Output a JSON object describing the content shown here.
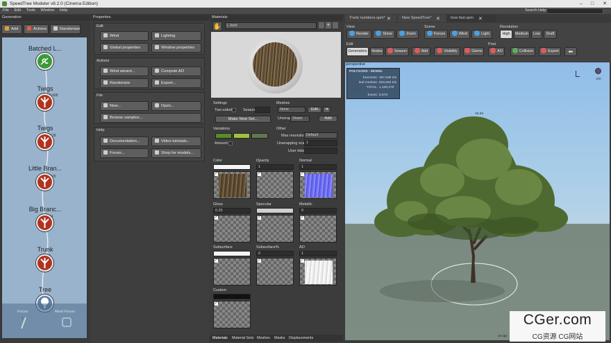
{
  "app_title": "SpeedTree Modeler v8.2.0 (Cinema Edition)",
  "menu": [
    "File",
    "Edit",
    "Tools",
    "Window",
    "Help"
  ],
  "search_label": "Search Help:",
  "generation": {
    "title": "Generation",
    "add": "Add",
    "actions": "Actions",
    "randomize": "Randomize",
    "nodes": [
      {
        "label": "Batched L...",
        "color": "#3a9a3a"
      },
      {
        "label": "Twigs",
        "color": "#b0331f"
      },
      {
        "label": "Twigs",
        "color": "#b0331f"
      },
      {
        "label": "Little Bran...",
        "color": "#b0331f"
      },
      {
        "label": "Big Branc...",
        "color": "#b0331f"
      },
      {
        "label": "Trunk",
        "color": "#b0331f"
      },
      {
        "label": "Tree",
        "color": "#5a7fb0"
      }
    ],
    "edge_counts": [
      "10,408",
      "4,128",
      "1,329",
      "204",
      "16",
      "1"
    ],
    "bottom": [
      "Forces",
      "Mesh Forces"
    ]
  },
  "properties": {
    "title": "Properties",
    "edit": {
      "heading": "Edit",
      "buttons": [
        "Wind",
        "Lighting",
        "Global properties",
        "Window properties"
      ]
    },
    "actions": {
      "heading": "Actions",
      "buttons": [
        "Wind wizard...",
        "Compute AO",
        "Randomize",
        "Export..."
      ]
    },
    "file": {
      "heading": "File",
      "buttons": [
        "New...",
        "Open...",
        "Browse samples..."
      ]
    },
    "help": {
      "heading": "Help",
      "buttons": [
        "Documentation...",
        "Video tutorials...",
        "Forum...",
        "Shop for models..."
      ]
    }
  },
  "materials": {
    "title": "Materials",
    "selected": "L.bark",
    "settings": {
      "heading": "Settings",
      "two_sided": "Two-sided",
      "season": "Season",
      "make_new_set": "Make New Set..."
    },
    "meshes": {
      "heading": "Meshes",
      "value": "None",
      "edit": "Edit...",
      "unwrap": "Unwrap",
      "unwrap_value": "Share",
      "add": "Add"
    },
    "variations": {
      "heading": "Variations",
      "amount": "Amount",
      "colors": [
        "#5a8a2a",
        "#a0c040",
        "#607850"
      ]
    },
    "other": {
      "heading": "Other",
      "max_resolution": "Max resolution",
      "max_resolution_value": "Default",
      "unwrapping_scale": "Unwrapping scale",
      "unwrapping_scale_value": "1",
      "user_data": "User data"
    },
    "maps": [
      {
        "name": "Color",
        "value": ""
      },
      {
        "name": "Opacity",
        "value": "1"
      },
      {
        "name": "Normal",
        "value": "1"
      },
      {
        "name": "Gloss",
        "value": "0.25"
      },
      {
        "name": "Specular",
        "value": ""
      },
      {
        "name": "Metallic",
        "value": "0"
      },
      {
        "name": "Subsurface",
        "value": ""
      },
      {
        "name": "Subsurface%",
        "value": "0"
      },
      {
        "name": "AO",
        "value": "1"
      },
      {
        "name": "Custom",
        "value": ""
      }
    ],
    "bottom_tabs": [
      "Materials",
      "Material Sets",
      "Meshes",
      "Masks",
      "Displacements"
    ]
  },
  "viewport": {
    "tabs": [
      "Trunk numbers.spm*",
      "New SpeedTree*",
      "how fast.spm"
    ],
    "groups": {
      "view": "View",
      "scene": "Scene",
      "resolution": "Resolution",
      "edit": "Edit",
      "post": "Post"
    },
    "view_buttons": [
      "Render",
      "Show",
      "Zoom"
    ],
    "scene_buttons": [
      "Forces",
      "Wind",
      "Light"
    ],
    "resolution_buttons": [
      "High",
      "Medium",
      "Low",
      "Draft"
    ],
    "edit_buttons": [
      "Generators",
      "Nodes",
      "Season",
      "Add",
      "Visibility",
      "Gizmo"
    ],
    "post_buttons": [
      "AO",
      "Collision",
      "Export"
    ],
    "camera": "perspective",
    "stats": {
      "title": "POLYGONS - MODEL",
      "branches_label": "branches:",
      "branches": "367,639 tris",
      "leaf_label": "leaf meshes:",
      "leaf": "832,640 tris",
      "total_label": "TOTAL:",
      "total": "1,100,279",
      "bones_label": "bones:",
      "bones": "5,678"
    },
    "height_label": "36.89",
    "zoom_label": "100",
    "corner": "18 ops"
  },
  "watermark": {
    "main": "CGer.com",
    "sub": "CG资源 CG网站"
  }
}
